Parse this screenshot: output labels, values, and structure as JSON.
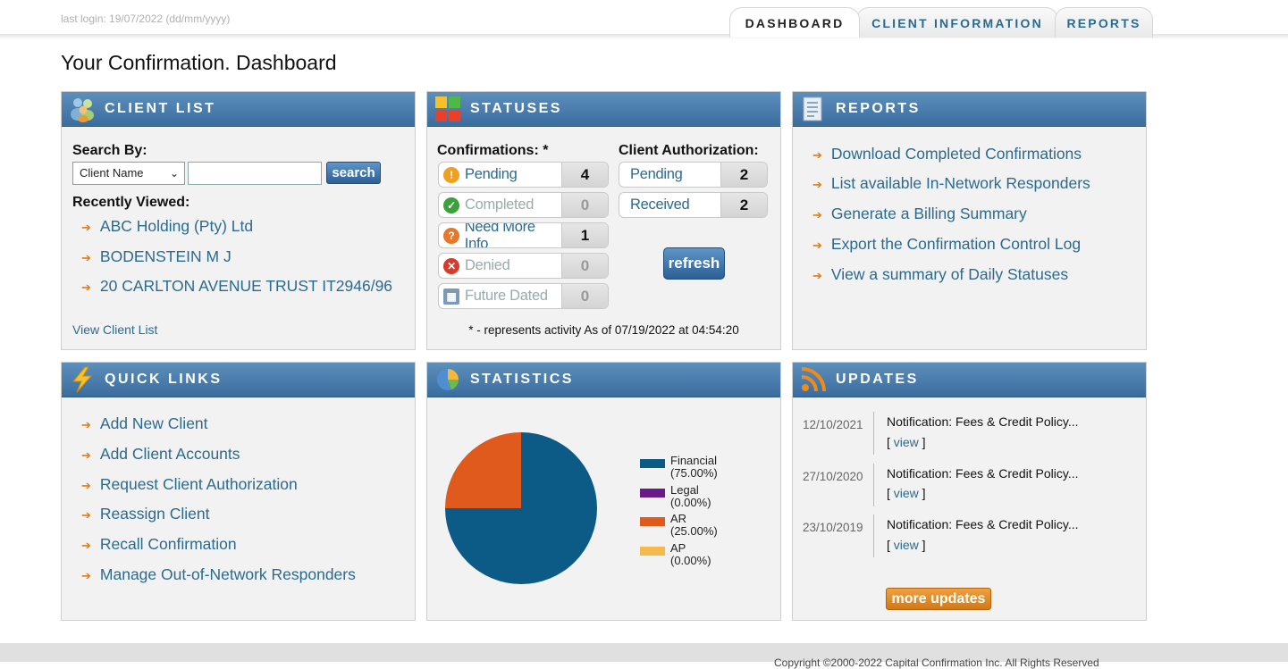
{
  "header": {
    "last_login": "last login: 19/07/2022 (dd/mm/yyyy)",
    "tabs": [
      "DASHBOARD",
      "CLIENT INFORMATION",
      "REPORTS"
    ],
    "active_tab": "DASHBOARD"
  },
  "page_title": "Your Confirmation. Dashboard",
  "client_list": {
    "title": "CLIENT LIST",
    "search_by_label": "Search By:",
    "search_select": "Client Name",
    "search_value": "",
    "search_button": "search",
    "recent_label": "Recently Viewed:",
    "recent": [
      "ABC Holding (Pty) Ltd",
      "BODENSTEIN M J",
      "20 CARLTON AVENUE TRUST IT2946/96"
    ],
    "view_all": "View Client List"
  },
  "statuses": {
    "title": "STATUSES",
    "confirmations_label": "Confirmations: *",
    "confirmations": [
      {
        "label": "Pending",
        "count": "4",
        "icon": "exclamation-icon",
        "color": "#f0a020"
      },
      {
        "label": "Completed",
        "count": "0",
        "icon": "check-icon",
        "color": "#3aa23a"
      },
      {
        "label": "Need More Info",
        "count": "1",
        "icon": "question-icon",
        "color": "#e6782a"
      },
      {
        "label": "Denied",
        "count": "0",
        "icon": "x-icon",
        "color": "#d93a2a"
      },
      {
        "label": "Future Dated",
        "count": "0",
        "icon": "calendar-icon",
        "color": "#7a9ab8"
      }
    ],
    "authorization_label": "Client Authorization:",
    "authorization": [
      {
        "label": "Pending",
        "count": "2"
      },
      {
        "label": "Received",
        "count": "2"
      }
    ],
    "refresh_button": "refresh",
    "activity_note": "* - represents activity As of 07/19/2022 at 04:54:20"
  },
  "reports": {
    "title": "REPORTS",
    "links": [
      "Download Completed Confirmations",
      "List available In-Network Responders",
      "Generate a Billing Summary",
      "Export the Confirmation Control Log",
      "View a summary of Daily Statuses"
    ]
  },
  "quick_links": {
    "title": "QUICK LINKS",
    "links": [
      "Add New Client",
      "Add Client Accounts",
      "Request Client Authorization",
      "Reassign Client",
      "Recall Confirmation",
      "Manage Out-of-Network Responders"
    ]
  },
  "statistics": {
    "title": "STATISTICS",
    "legend": [
      {
        "label": "Financial",
        "pct": "(75.00%)"
      },
      {
        "label": "Legal",
        "pct": "(0.00%)"
      },
      {
        "label": "AR",
        "pct": "(25.00%)"
      },
      {
        "label": "AP",
        "pct": "(0.00%)"
      }
    ]
  },
  "chart_data": {
    "type": "pie",
    "categories": [
      "Financial",
      "Legal",
      "AR",
      "AP"
    ],
    "values": [
      75.0,
      0.0,
      25.0,
      0.0
    ],
    "colors": [
      "#0b5b86",
      "#6a1b8a",
      "#e05a1e",
      "#f6b94c"
    ],
    "legend_position": "right"
  },
  "updates": {
    "title": "UPDATES",
    "items": [
      {
        "date": "12/10/2021",
        "title": "Notification: Fees & Credit Policy...",
        "view_pre": "[ ",
        "view": "view",
        "view_post": " ]"
      },
      {
        "date": "27/10/2020",
        "title": "Notification: Fees & Credit Policy...",
        "view_pre": "[ ",
        "view": "view",
        "view_post": " ]"
      },
      {
        "date": "23/10/2019",
        "title": "Notification: Fees & Credit Policy...",
        "view_pre": "[ ",
        "view": "view",
        "view_post": " ]"
      }
    ],
    "more_button": "more updates"
  },
  "footer": {
    "copyright": "Copyright ©2000-2022 Capital Confirmation Inc. All Rights Reserved"
  },
  "colors": {
    "header_blue": "#3a6d9e",
    "link_blue": "#2b6a8f",
    "arrow_orange": "#e07b1a"
  }
}
